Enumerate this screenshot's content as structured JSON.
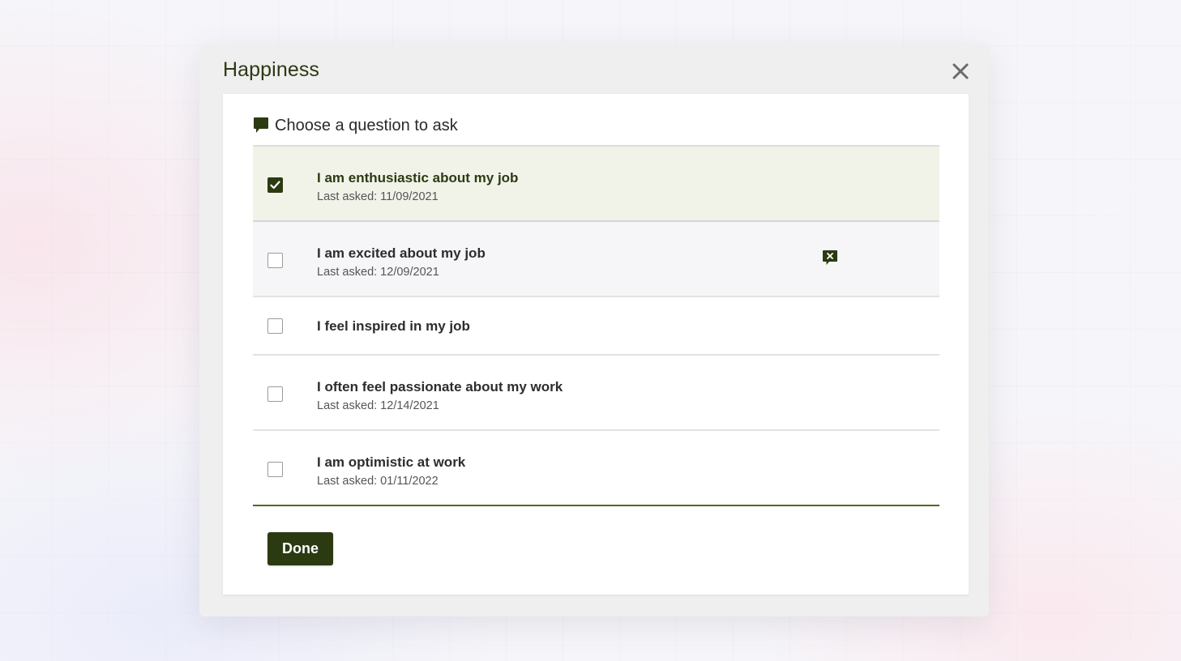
{
  "modal": {
    "title": "Happiness",
    "close_label": "×"
  },
  "card": {
    "heading": "Choose a question to ask",
    "heading_icon": "speech-bubble-icon"
  },
  "questions": [
    {
      "label": "I am enthusiastic about my job",
      "last_asked": "Last asked: 11/09/2021",
      "checked": true
    },
    {
      "label": "I am excited about my job",
      "last_asked": "Last asked: 12/09/2021",
      "checked": false,
      "hovered": true
    },
    {
      "label": "I feel inspired in my job",
      "last_asked": "",
      "checked": false
    },
    {
      "label": "I often feel passionate about my work",
      "last_asked": "Last asked: 12/14/2021",
      "checked": false
    },
    {
      "label": "I am optimistic at work",
      "last_asked": "Last asked: 01/11/2022",
      "checked": false
    }
  ],
  "actions": {
    "done_label": "Done"
  },
  "colors": {
    "accent": "#2c3a12",
    "selected_row": "#f1f3e9",
    "list_bottom_rule": "#4f6b1c"
  }
}
